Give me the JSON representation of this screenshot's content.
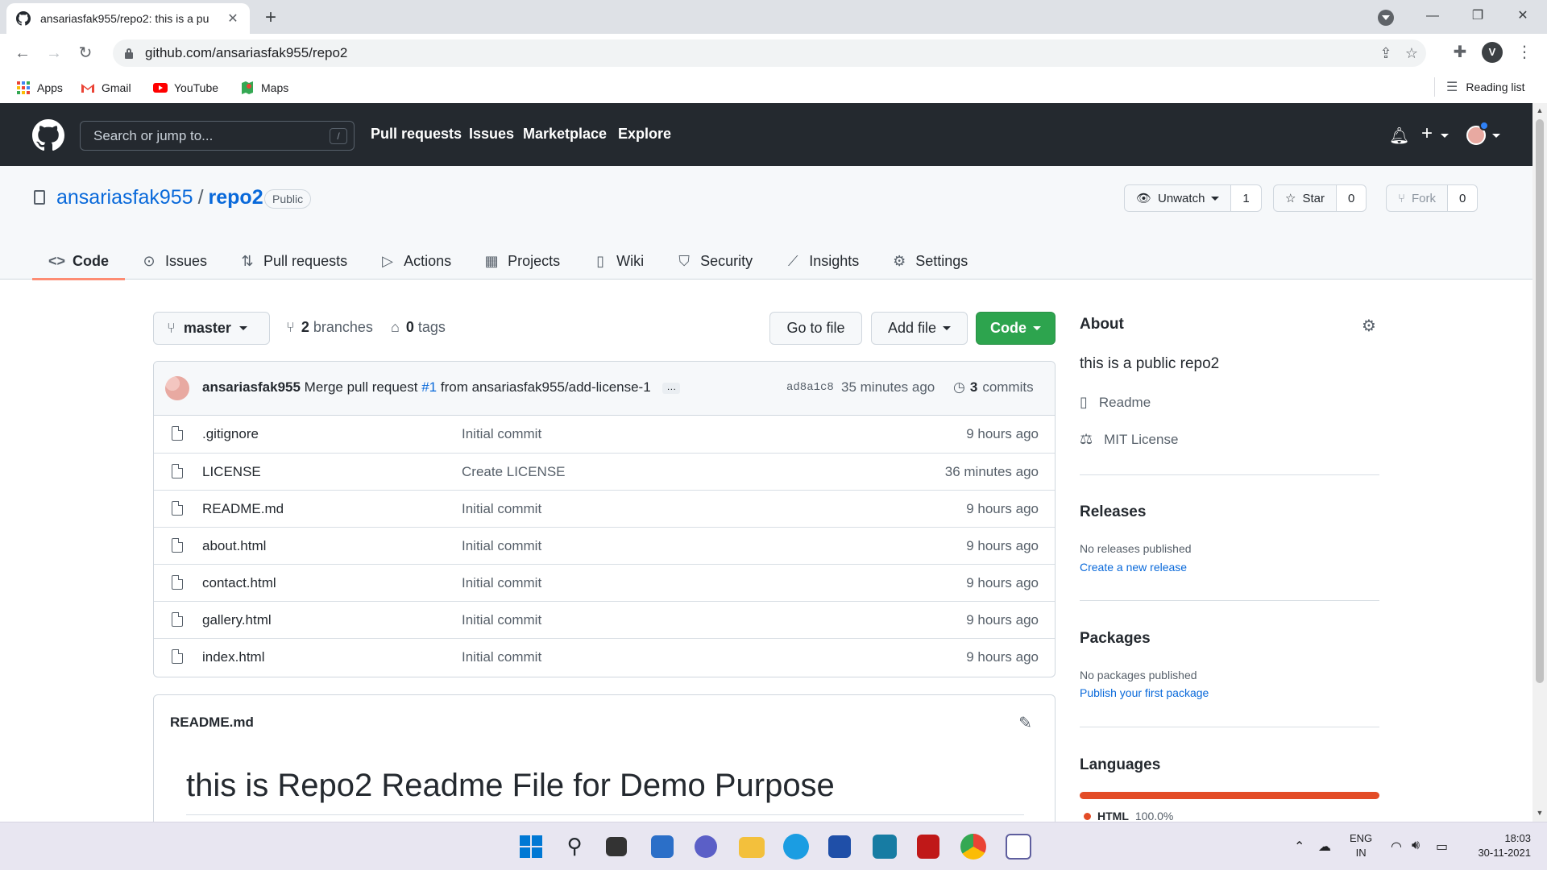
{
  "browser": {
    "tab_title": "ansariasfak955/repo2: this is a pu",
    "url": "github.com/ansariasfak955/repo2",
    "profile_initial": "V",
    "bookmarks": [
      {
        "label": "Apps",
        "icon": "apps-grid-icon"
      },
      {
        "label": "Gmail",
        "icon": "gmail-icon"
      },
      {
        "label": "YouTube",
        "icon": "youtube-icon"
      },
      {
        "label": "Maps",
        "icon": "maps-icon"
      }
    ],
    "reading_list": "Reading list"
  },
  "gh_header": {
    "search_placeholder": "Search or jump to...",
    "search_key": "/",
    "nav": [
      "Pull requests",
      "Issues",
      "Marketplace",
      "Explore"
    ]
  },
  "repo": {
    "owner": "ansariasfak955",
    "separator": "/",
    "name": "repo2",
    "visibility": "Public",
    "unwatch_label": "Unwatch",
    "watch_count": "1",
    "star_label": "Star",
    "star_count": "0",
    "fork_label": "Fork",
    "fork_count": "0",
    "tabs": [
      {
        "label": "Code",
        "icon": "code-icon",
        "glyph": "<>"
      },
      {
        "label": "Issues",
        "icon": "issue-icon",
        "glyph": "⊙"
      },
      {
        "label": "Pull requests",
        "icon": "pull-request-icon",
        "glyph": "⇅"
      },
      {
        "label": "Actions",
        "icon": "play-icon",
        "glyph": "▷"
      },
      {
        "label": "Projects",
        "icon": "project-icon",
        "glyph": "▦"
      },
      {
        "label": "Wiki",
        "icon": "book-icon",
        "glyph": "▯"
      },
      {
        "label": "Security",
        "icon": "shield-icon",
        "glyph": "⛉"
      },
      {
        "label": "Insights",
        "icon": "graph-icon",
        "glyph": "⟋"
      },
      {
        "label": "Settings",
        "icon": "gear-icon",
        "glyph": "⚙"
      }
    ]
  },
  "toolbar": {
    "branch": "master",
    "branches_count": "2",
    "branches_label": "branches",
    "tags_count": "0",
    "tags_label": "tags",
    "go_to_file": "Go to file",
    "add_file": "Add file",
    "code": "Code"
  },
  "commit": {
    "author": "ansariasfak955",
    "message_pre": "Merge pull request",
    "pr": "#1",
    "message_post": "from ansariasfak955/add-license-1",
    "ellipsis": "…",
    "sha": "ad8a1c8",
    "time": "35 minutes ago",
    "commits_count": "3",
    "commits_label": "commits"
  },
  "files": [
    {
      "name": ".gitignore",
      "message": "Initial commit",
      "time": "9 hours ago"
    },
    {
      "name": "LICENSE",
      "message": "Create LICENSE",
      "time": "36 minutes ago"
    },
    {
      "name": "README.md",
      "message": "Initial commit",
      "time": "9 hours ago"
    },
    {
      "name": "about.html",
      "message": "Initial commit",
      "time": "9 hours ago"
    },
    {
      "name": "contact.html",
      "message": "Initial commit",
      "time": "9 hours ago"
    },
    {
      "name": "gallery.html",
      "message": "Initial commit",
      "time": "9 hours ago"
    },
    {
      "name": "index.html",
      "message": "Initial commit",
      "time": "9 hours ago"
    }
  ],
  "readme": {
    "filename": "README.md",
    "heading": "this is Repo2 Readme File for Demo Purpose"
  },
  "sidebar": {
    "about_title": "About",
    "description": "this is a public repo2",
    "readme_link": "Readme",
    "license_link": "MIT License",
    "releases_title": "Releases",
    "releases_none": "No releases published",
    "releases_create": "Create a new release",
    "packages_title": "Packages",
    "packages_none": "No packages published",
    "packages_publish": "Publish your first package",
    "languages_title": "Languages",
    "languages": [
      {
        "name": "HTML",
        "percent": "100.0%",
        "color": "#e34c26"
      }
    ]
  },
  "taskbar": {
    "lang_top": "ENG",
    "lang_bottom": "IN",
    "time": "18:03",
    "date": "30-11-2021"
  },
  "colors": {
    "gh_header": "#24292f",
    "link": "#0969da",
    "code_button": "#2da44e",
    "active_tab_underline": "#fd8c73"
  }
}
